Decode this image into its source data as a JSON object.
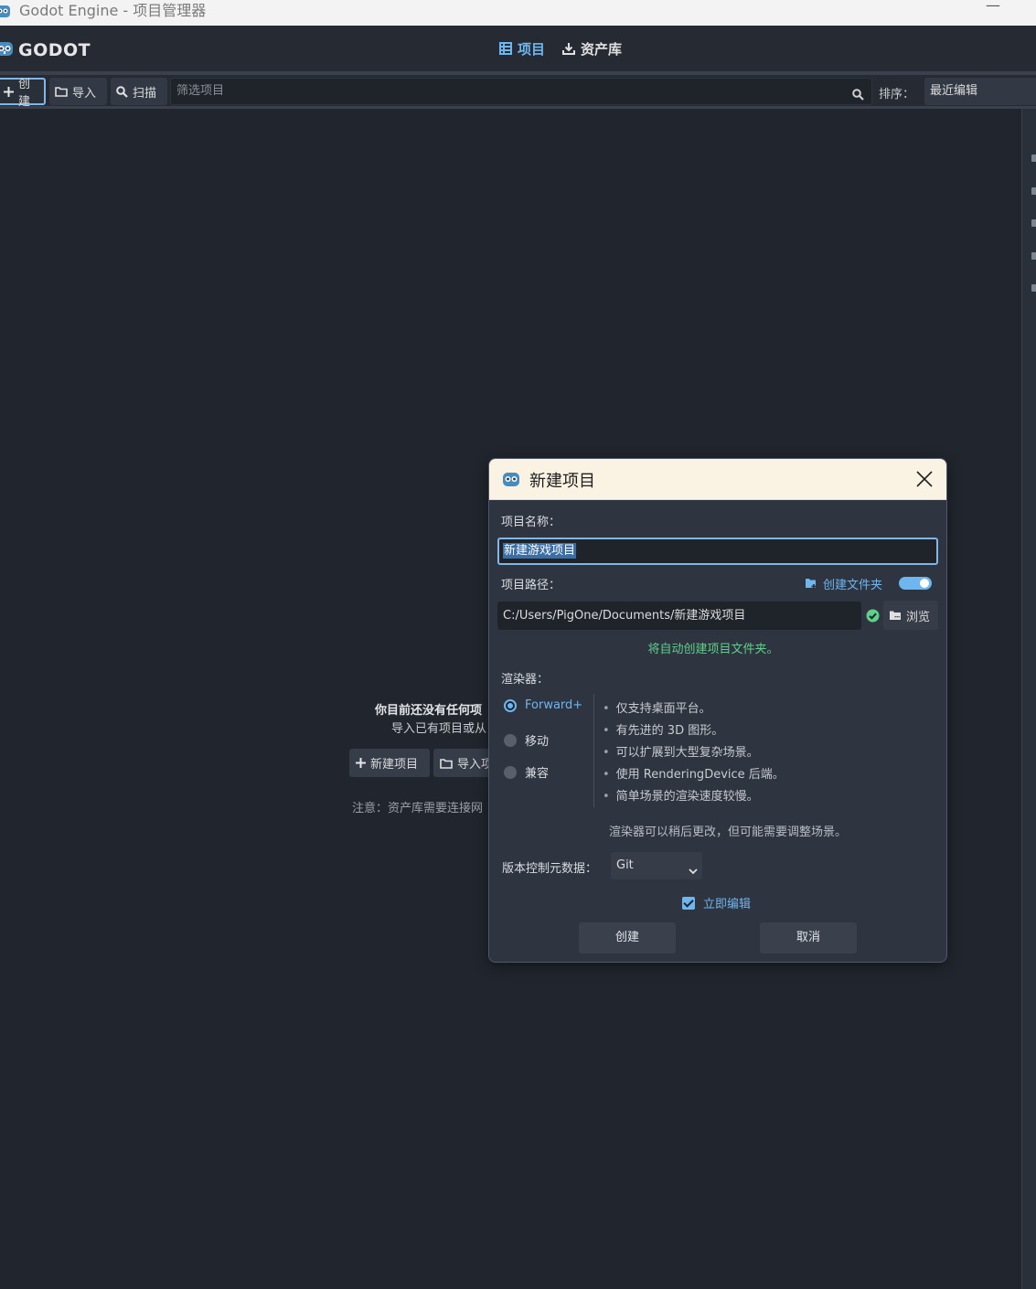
{
  "window": {
    "title": "Godot Engine - 项目管理器",
    "minimize_glyph": "—"
  },
  "topbar": {
    "logo_text": "GODOT",
    "tabs": [
      {
        "label": "项目",
        "icon": "project-list-icon",
        "active": true
      },
      {
        "label": "资产库",
        "icon": "download-icon",
        "active": false
      }
    ]
  },
  "toolbar": {
    "create_label": "创建",
    "import_label": "导入",
    "scan_label": "扫描",
    "filter_placeholder": "筛选项目",
    "sort_label": "排序：",
    "sort_value": "最近编辑"
  },
  "empty_state": {
    "title": "你目前还没有任何项",
    "subtitle": "导入已有项目或从",
    "new_project_label": "新建项目",
    "import_label": "导入项",
    "note": "注意：资产库需要连接网"
  },
  "dialog": {
    "title": "新建项目",
    "project_name_label": "项目名称：",
    "project_name_value": "新建游戏项目",
    "project_path_label": "项目路径：",
    "create_folder_label": "创建文件夹",
    "create_folder_enabled": true,
    "project_path_value": "C:/Users/PigOne/Documents/新建游戏项目",
    "browse_label": "浏览",
    "auto_create_message": "将自动创建项目文件夹。",
    "renderer_label": "渲染器：",
    "renderers": [
      {
        "label": "Forward+",
        "selected": true
      },
      {
        "label": "移动",
        "selected": false
      },
      {
        "label": "兼容",
        "selected": false
      }
    ],
    "renderer_features": [
      "仅支持桌面平台。",
      "有先进的 3D 图形。",
      "可以扩展到大型复杂场景。",
      "使用 RenderingDevice 后端。",
      "简单场景的渲染速度较慢。"
    ],
    "renderer_note": "渲染器可以稍后更改，但可能需要调整场景。",
    "vcs_label": "版本控制元数据：",
    "vcs_value": "Git",
    "edit_now_label": "立即编辑",
    "edit_now_checked": true,
    "create_button": "创建",
    "cancel_button": "取消"
  },
  "colors": {
    "accent": "#6eb6f0",
    "background": "#21262e",
    "success": "#5fd08a",
    "dialog_title_bg": "#faf3e3"
  }
}
